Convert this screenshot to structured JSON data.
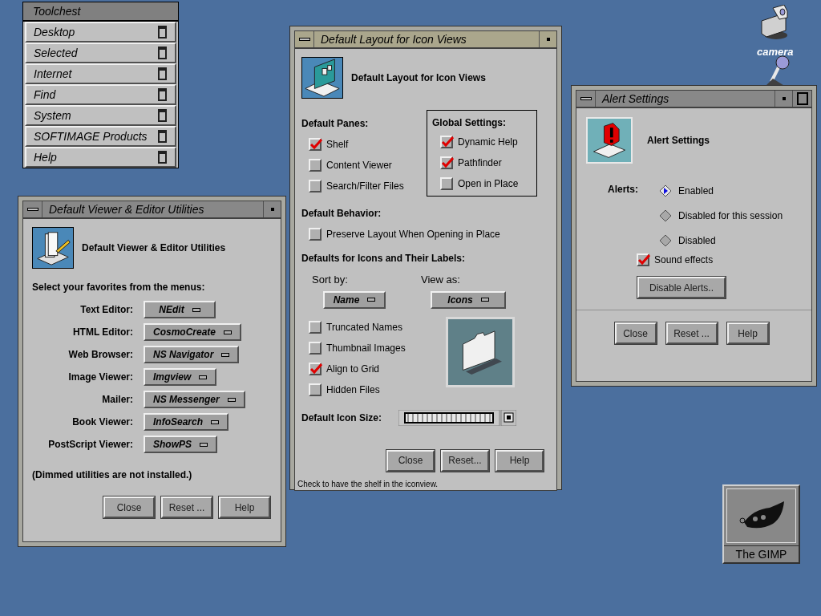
{
  "desktop": {
    "camera_label": "camera",
    "gimp_label": "The GIMP"
  },
  "toolchest": {
    "title": "Toolchest",
    "items": [
      "Desktop",
      "Selected",
      "Internet",
      "Find",
      "System",
      "SOFTIMAGE Products",
      "Help"
    ]
  },
  "viewer_window": {
    "title": "Default Viewer & Editor Utilities",
    "active": false,
    "heading": "Default Viewer & Editor Utilities",
    "prompt": "Select your favorites from the menus:",
    "utilities": [
      {
        "label": "Text Editor:",
        "value": "NEdit"
      },
      {
        "label": "HTML Editor:",
        "value": "CosmoCreate"
      },
      {
        "label": "Web Browser:",
        "value": "NS Navigator"
      },
      {
        "label": "Image Viewer:",
        "value": "Imgview"
      },
      {
        "label": "Mailer:",
        "value": "NS Messenger"
      },
      {
        "label": "Book Viewer:",
        "value": "InfoSearch"
      },
      {
        "label": "PostScript Viewer:",
        "value": "ShowPS"
      }
    ],
    "note": "(Dimmed utilities are not installed.)",
    "buttons": [
      "Close",
      "Reset ...",
      "Help"
    ]
  },
  "layout_window": {
    "title": "Default Layout for Icon Views",
    "active": true,
    "heading": "Default Layout for Icon Views",
    "panes": {
      "title": "Default Panes:",
      "options": [
        {
          "label": "Shelf",
          "checked": true
        },
        {
          "label": "Content Viewer",
          "checked": false
        },
        {
          "label": "Search/Filter Files",
          "checked": false
        }
      ]
    },
    "global": {
      "title": "Global Settings:",
      "options": [
        {
          "label": "Dynamic Help",
          "checked": true
        },
        {
          "label": "Pathfinder",
          "checked": true
        },
        {
          "label": "Open in Place",
          "checked": false
        }
      ]
    },
    "behavior": {
      "title": "Default Behavior:",
      "options": [
        {
          "label": "Preserve Layout When Opening in Place",
          "checked": false
        }
      ]
    },
    "labels": {
      "title": "Defaults for Icons and Their Labels:",
      "sort_label": "Sort by:",
      "sort_value": "Name",
      "view_label": "View as:",
      "view_value": "Icons",
      "options": [
        {
          "label": "Truncated Names",
          "checked": false
        },
        {
          "label": "Thumbnail Images",
          "checked": false
        },
        {
          "label": "Align to Grid",
          "checked": true
        },
        {
          "label": "Hidden Files",
          "checked": false
        }
      ]
    },
    "size_label": "Default Icon Size:",
    "buttons": [
      "Close",
      "Reset...",
      "Help"
    ],
    "status": "Check to have the shelf in the iconview."
  },
  "alert_window": {
    "title": "Alert Settings",
    "active": false,
    "heading": "Alert Settings",
    "alerts_label": "Alerts:",
    "options": [
      {
        "label": "Enabled",
        "selected": true
      },
      {
        "label": "Disabled for this session",
        "selected": false
      },
      {
        "label": "Disabled",
        "selected": false
      }
    ],
    "sound": {
      "label": "Sound effects",
      "checked": true
    },
    "disable_button": "Disable Alerts..",
    "buttons": [
      "Close",
      "Reset ...",
      "Help"
    ]
  }
}
